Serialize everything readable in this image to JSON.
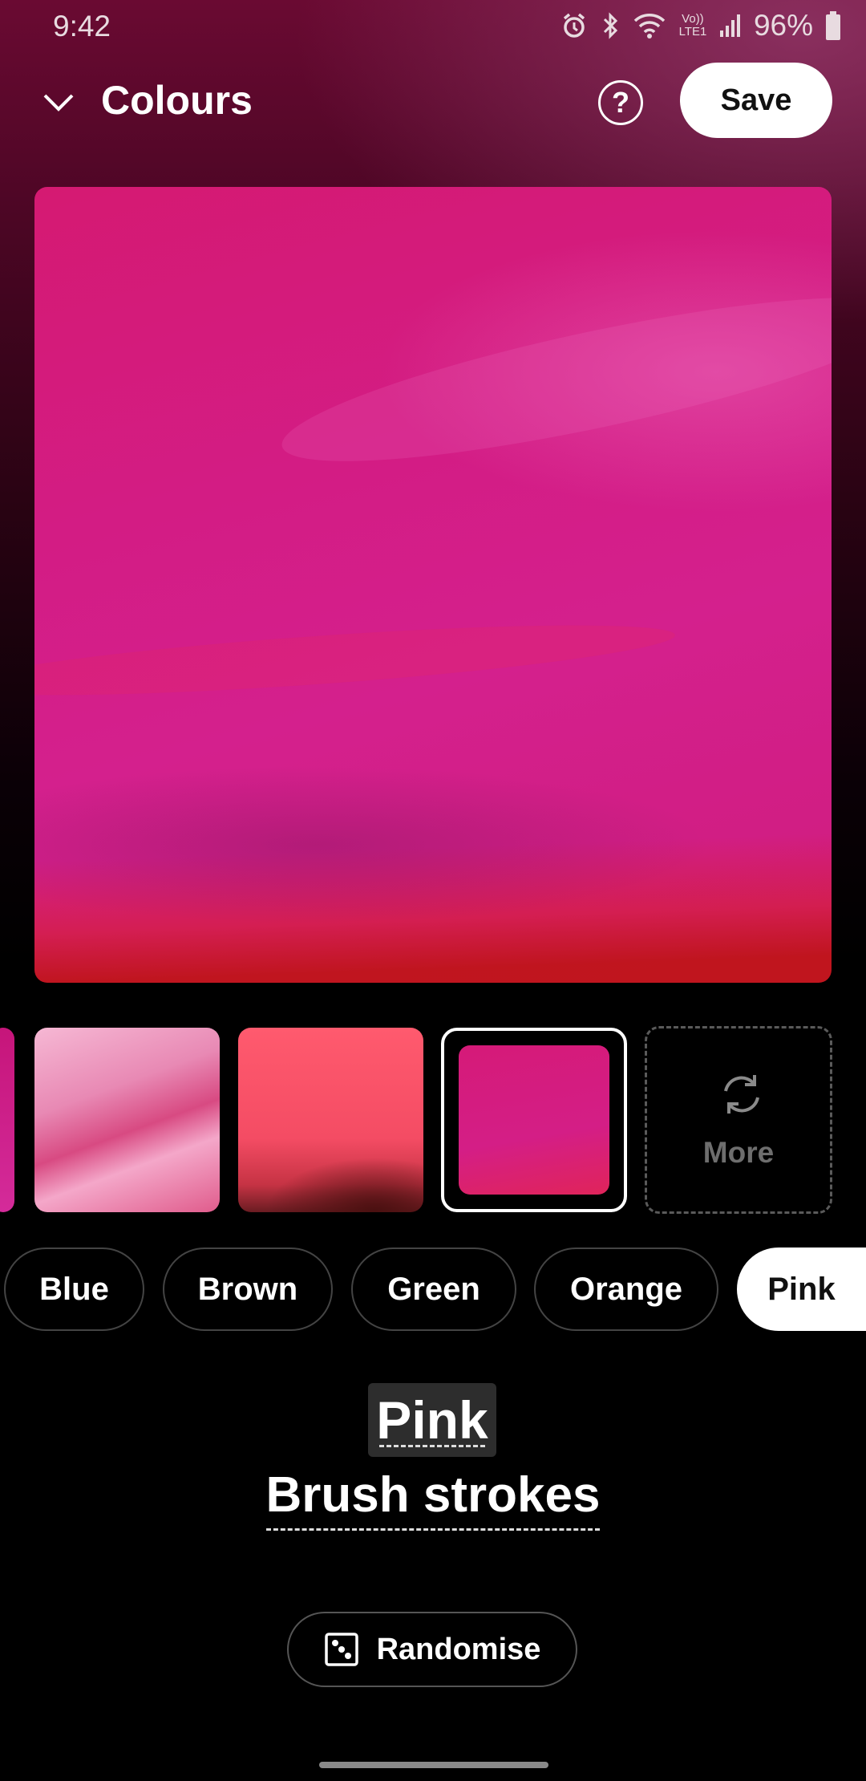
{
  "status_bar": {
    "time": "9:42",
    "battery": "96%",
    "network_label": "Vo)) LTE1"
  },
  "header": {
    "title": "Colours",
    "save_label": "Save"
  },
  "thumbnails": {
    "more_label": "More"
  },
  "chips": [
    "Blue",
    "Brown",
    "Green",
    "Orange",
    "Pink"
  ],
  "selected_chip": "Pink",
  "labels": {
    "colour_name": "Pink",
    "style_name": "Brush strokes"
  },
  "randomise_label": "Randomise",
  "colors": {
    "accent_pink": "#d41e84",
    "background": "#000000",
    "header_tint": "#6a0a32"
  }
}
